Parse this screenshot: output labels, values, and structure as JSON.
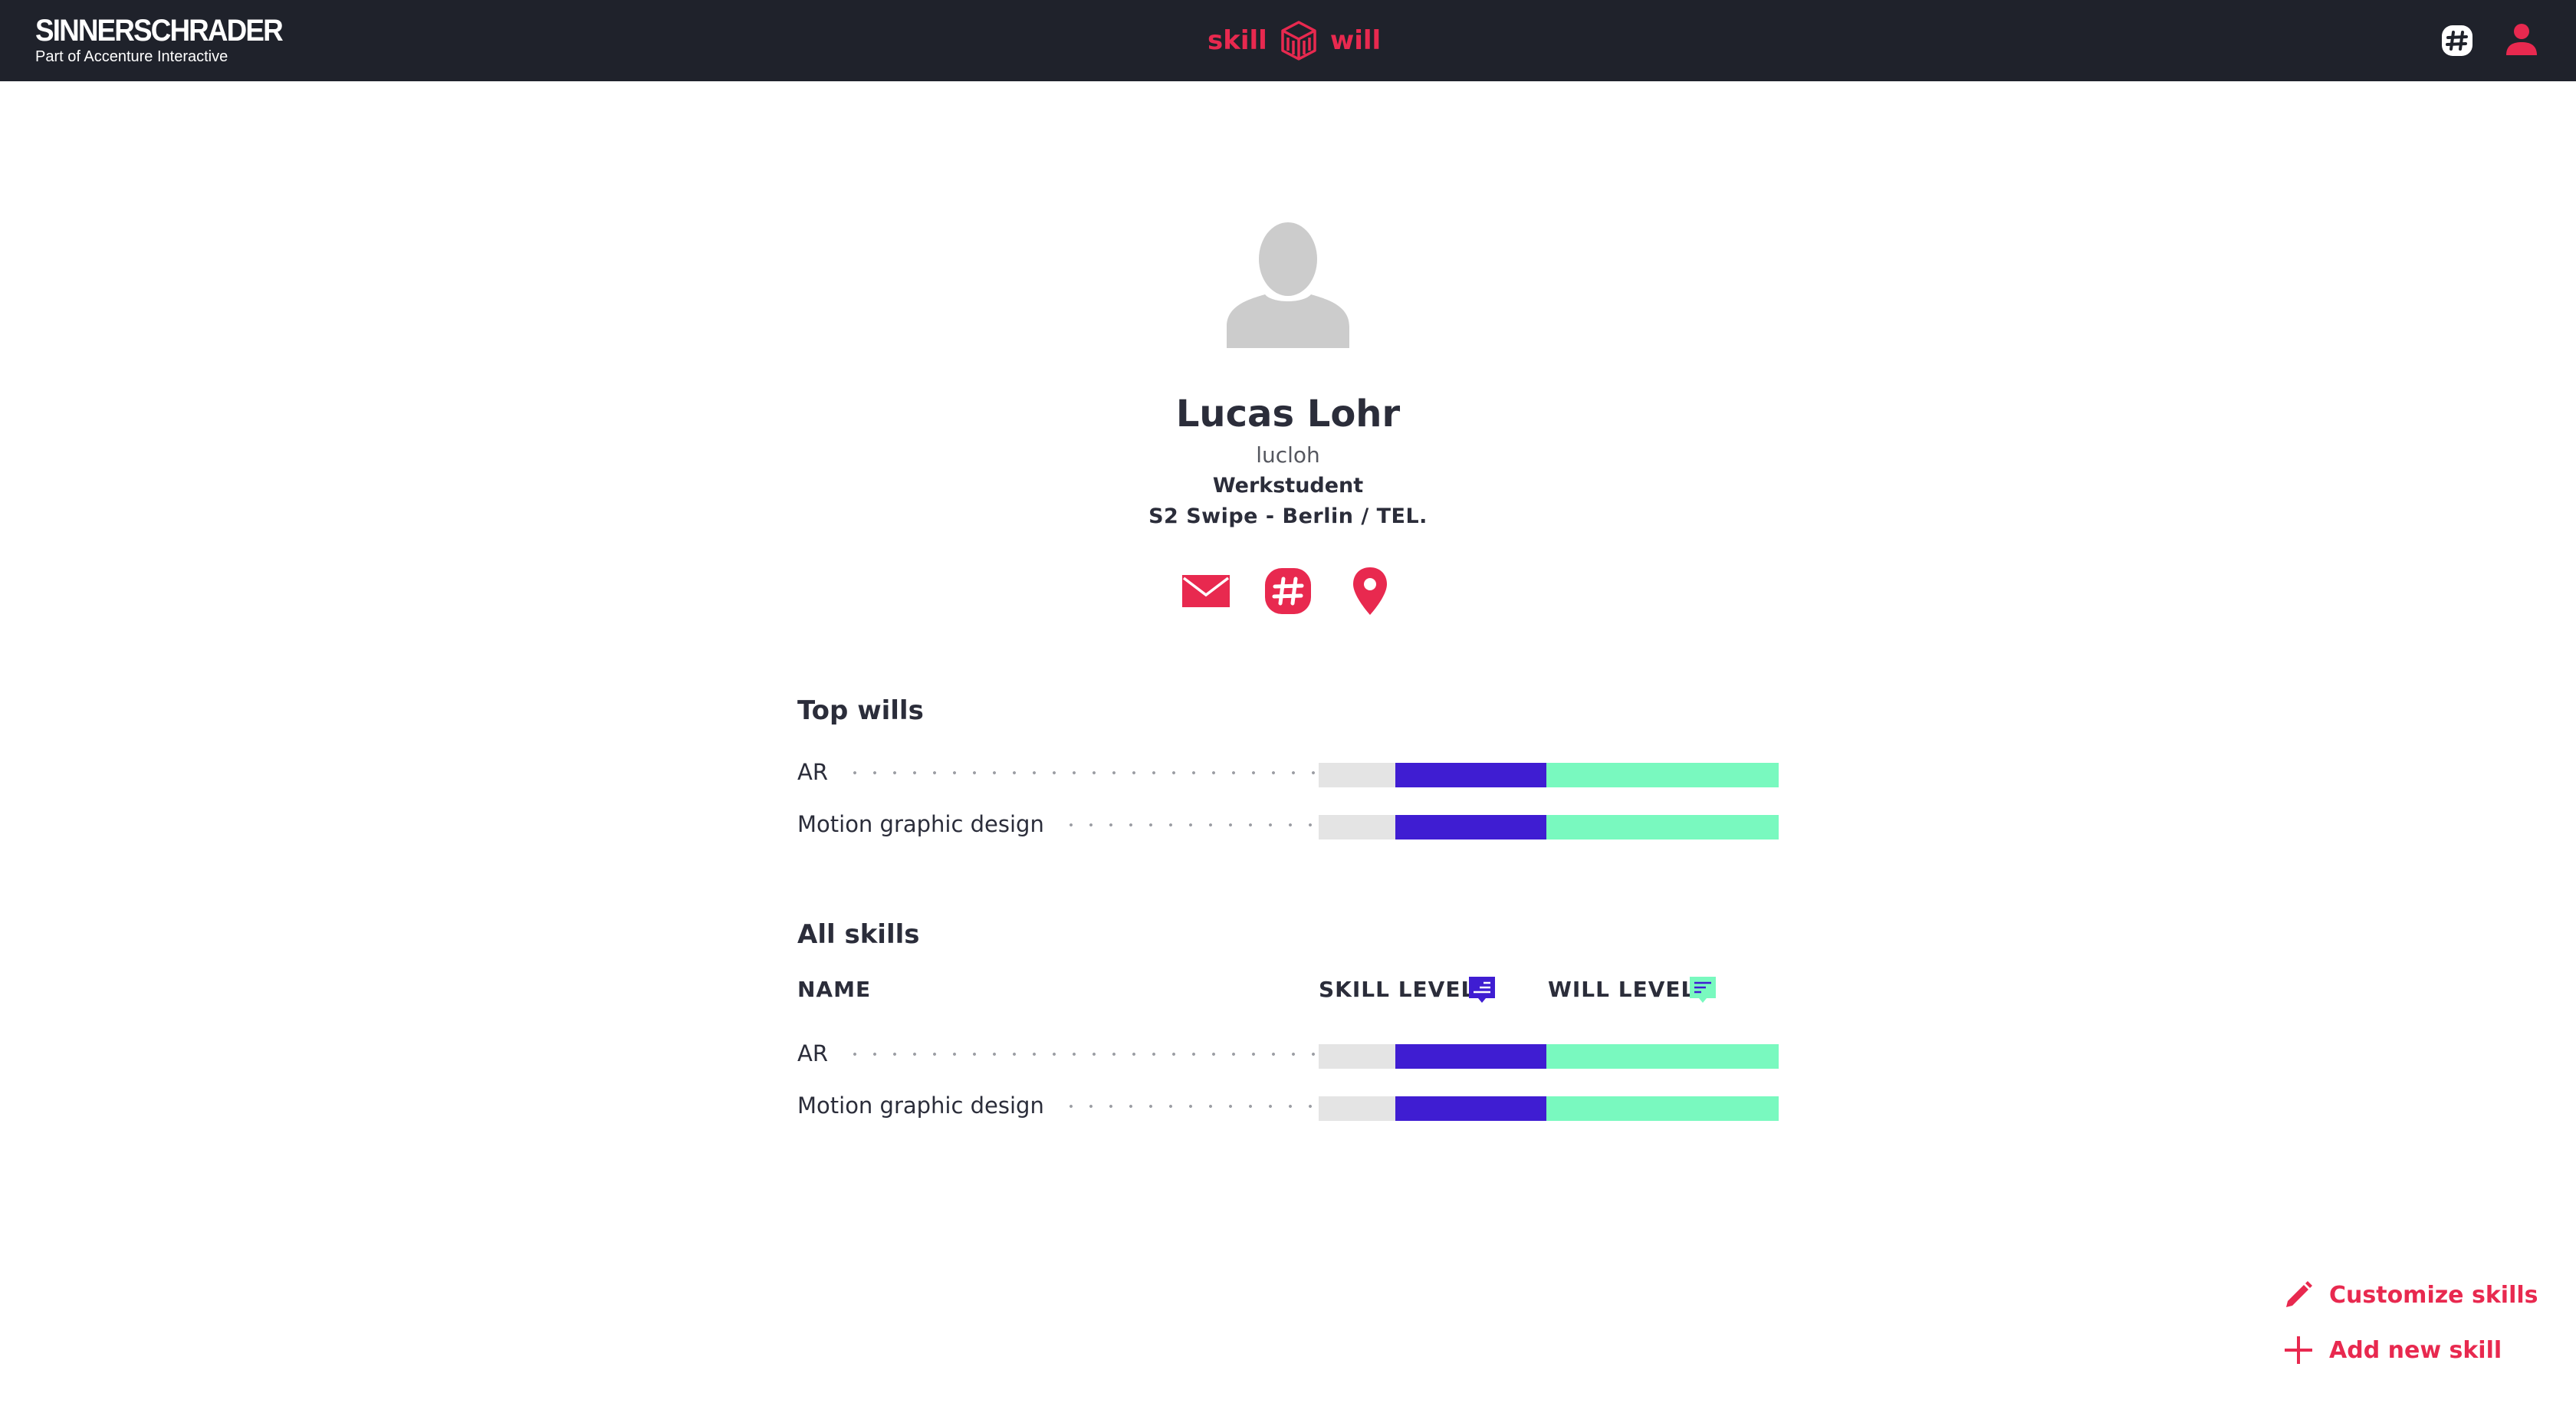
{
  "colors": {
    "accent": "#e8294f",
    "topbar": "#1f222b",
    "skill_bar": "#3f1dd2",
    "will_bar": "#79f9bf",
    "bar_base": "#e4e4e4"
  },
  "header": {
    "brand_name": "SINNERSCHRADER",
    "brand_sub": "Part of Accenture Interactive",
    "logo_left": "skill",
    "logo_right": "will",
    "icons": [
      "slack-icon",
      "user-icon"
    ]
  },
  "profile": {
    "avatar_icon": "person-placeholder-icon",
    "name": "Lucas Lohr",
    "username": "lucloh",
    "title": "Werkstudent",
    "location": "S2 Swipe - Berlin / TEL.",
    "contact_icons": [
      "mail-icon",
      "slack-icon",
      "location-pin-icon"
    ]
  },
  "top_wills": {
    "title": "Top wills",
    "items": [
      {
        "name": "AR",
        "skill_level": 1,
        "will_level": 3
      },
      {
        "name": "Motion graphic design",
        "skill_level": 1,
        "will_level": 3
      }
    ]
  },
  "all_skills": {
    "title": "All skills",
    "col_name": "NAME",
    "col_skill": "SKILL LEVEL",
    "col_will": "WILL LEVEL",
    "items": [
      {
        "name": "AR",
        "skill_level": 1,
        "will_level": 3
      },
      {
        "name": "Motion graphic design",
        "skill_level": 1,
        "will_level": 3
      }
    ]
  },
  "actions": {
    "customize_label": "Customize skills",
    "add_label": "Add new skill"
  }
}
